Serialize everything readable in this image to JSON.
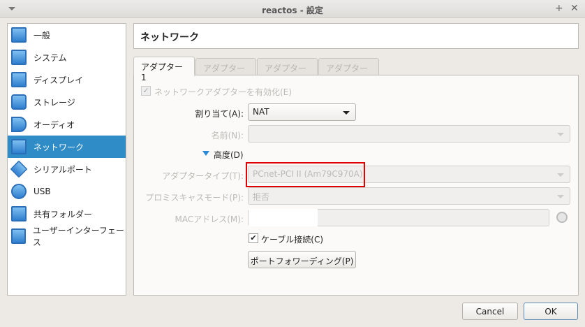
{
  "window": {
    "title": "reactos - 設定"
  },
  "sidebar": {
    "items": [
      {
        "label": "一般",
        "icon": "monitor-icon"
      },
      {
        "label": "システム",
        "icon": "chip-icon"
      },
      {
        "label": "ディスプレイ",
        "icon": "display-icon"
      },
      {
        "label": "ストレージ",
        "icon": "disk-icon"
      },
      {
        "label": "オーディオ",
        "icon": "speaker-icon"
      },
      {
        "label": "ネットワーク",
        "icon": "network-icon",
        "selected": true
      },
      {
        "label": "シリアルポート",
        "icon": "serial-port-icon"
      },
      {
        "label": "USB",
        "icon": "usb-icon"
      },
      {
        "label": "共有フォルダー",
        "icon": "folder-icon"
      },
      {
        "label": "ユーザーインターフェース",
        "icon": "ui-icon"
      }
    ]
  },
  "header": {
    "title": "ネットワーク"
  },
  "tabs": [
    "アダプター 1",
    "アダプター 2",
    "アダプター 3",
    "アダプター 4"
  ],
  "form": {
    "enable_adapter": "ネットワークアダプターを有効化(E)",
    "attached_label": "割り当て(A):",
    "attached_value": "NAT",
    "name_label": "名前(N):",
    "name_value": "",
    "advanced": "高度(D)",
    "adapter_type_label": "アダプタータイプ(T):",
    "adapter_type_value": "PCnet-PCI II (Am79C970A)",
    "promisc_label": "プロミスキャスモード(P):",
    "promisc_value": "拒否",
    "mac_label": "MACアドレス(M):",
    "cable_label": "ケーブル接続(C)",
    "port_forwarding": "ポートフォワーディング(P)"
  },
  "buttons": {
    "cancel": "Cancel",
    "ok": "OK"
  },
  "colors": {
    "selection": "#308cc6",
    "highlight_box": "#e00000"
  }
}
